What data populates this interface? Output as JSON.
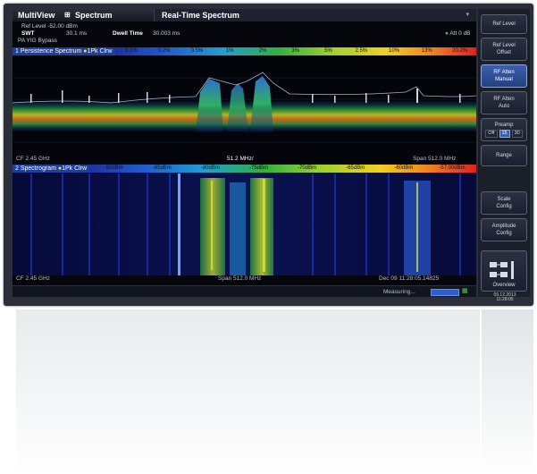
{
  "header": {
    "app_title": "MultiView",
    "mode": "Spectrum",
    "tab_title": "Real-Time Spectrum"
  },
  "settings": {
    "ref_level": "Ref Level -52.00 dBm",
    "swt_label": "SWT",
    "swt_value": "30.1 ms",
    "dwell_label": "Dwell Time",
    "dwell_value": "30.003 ms",
    "pa": "PA YIG Bypass",
    "att": "Att 0 dB"
  },
  "panels": {
    "persistence": {
      "title": "1 Persistence Spectrum",
      "trace": "1Pk Clrw",
      "scale": [
        "0.1%",
        "0.2%",
        "0.5%",
        "1%",
        "2%",
        "3%",
        "5%",
        "2.5%",
        "10%",
        "13%",
        "20.2%"
      ],
      "center": "CF 2.45 GHz",
      "division": "51.2 MHz/",
      "span": "Span 512.0 MHz"
    },
    "spectrogram": {
      "title": "2 Spectrogram",
      "trace": "1Pk Clrw",
      "scale": [
        "-90dBm",
        "-85dBm",
        "-80dBm",
        "-75dBm",
        "-70dBm",
        "-65dBm",
        "-60dBm",
        "-57.00dBm"
      ],
      "center": "CF 2.45 GHz",
      "span": "Span 512.0 MHz",
      "timestamp": "Dec 09 11:28:05.14825"
    }
  },
  "status": {
    "measuring": "Measuring...",
    "date": "09.12.2013",
    "time": "11:28:05"
  },
  "softkeys": {
    "ref_level": "Ref Level",
    "ref_level_offset_1": "Ref Level",
    "ref_level_offset_2": "Offset",
    "rf_atten_manual_1": "RF Atten",
    "rf_atten_manual_2": "Manual",
    "rf_atten_auto_1": "RF Atten",
    "rf_atten_auto_2": "Auto",
    "preamp": "Preamp",
    "preamp_off": "Off",
    "preamp_15": "15",
    "preamp_30": "30",
    "range": "Range",
    "scale_config_1": "Scale",
    "scale_config_2": "Config",
    "amplitude_config_1": "Amplitude",
    "amplitude_config_2": "Config",
    "overview": "Overview"
  },
  "colors": {
    "accent": "#1e3f9a",
    "softkey_active": "#3b5fb0"
  }
}
